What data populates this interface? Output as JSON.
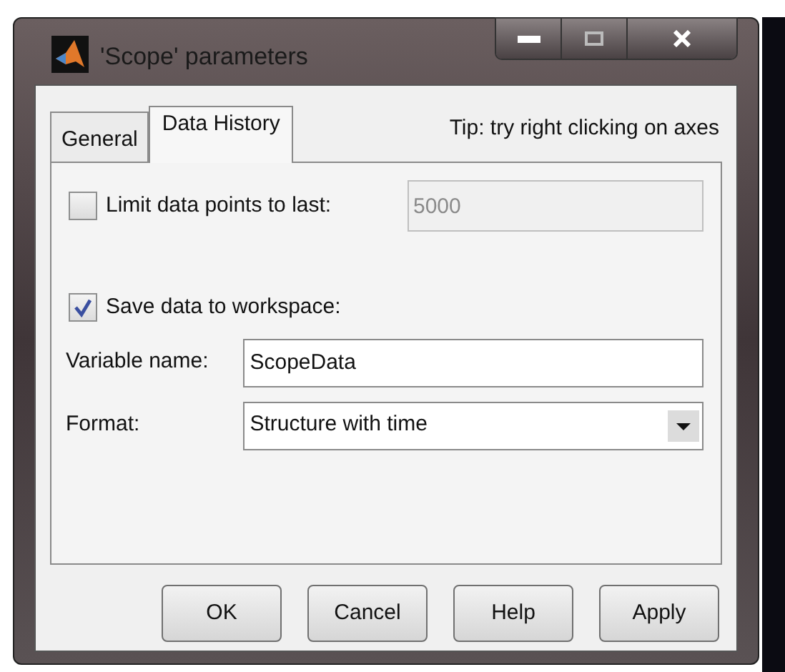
{
  "window": {
    "title": "'Scope' parameters"
  },
  "tabs": [
    {
      "label": "General",
      "selected": false
    },
    {
      "label": "Data History",
      "selected": true
    }
  ],
  "tip": "Tip: try right clicking on axes",
  "limit": {
    "label": "Limit data points to last:",
    "checked": false,
    "value": "5000",
    "disabled": true
  },
  "save": {
    "label": "Save data to workspace:",
    "checked": true
  },
  "variable_name": {
    "label": "Variable name:",
    "value": "ScopeData"
  },
  "format": {
    "label": "Format:",
    "value": "Structure with time"
  },
  "buttons": [
    "OK",
    "Cancel",
    "Help",
    "Apply"
  ]
}
